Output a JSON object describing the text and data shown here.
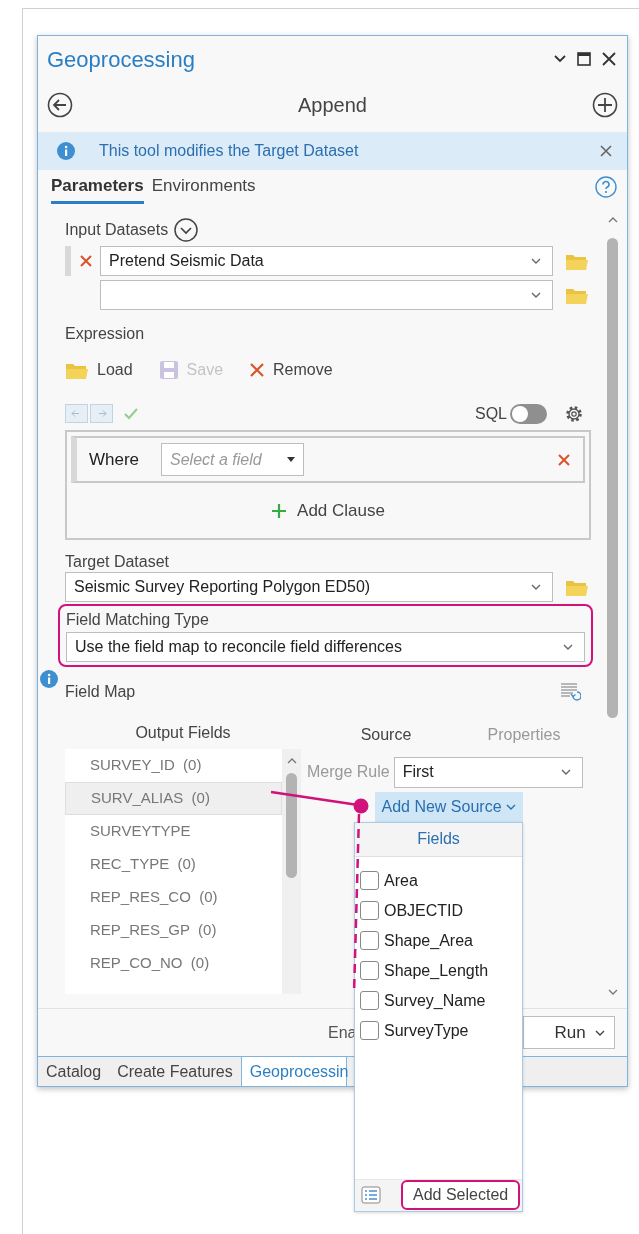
{
  "window": {
    "title": "Geoprocessing"
  },
  "tool": {
    "title": "Append"
  },
  "banner": {
    "text": "This tool modifies the Target Dataset"
  },
  "tabs": [
    {
      "label": "Parameters",
      "selected": true
    },
    {
      "label": "Environments",
      "selected": false
    }
  ],
  "input_datasets": {
    "label": "Input Datasets",
    "rows": [
      {
        "value": "Pretend Seismic Data",
        "removable": true
      },
      {
        "removable": false
      }
    ]
  },
  "expression": {
    "label": "Expression",
    "actions": [
      {
        "kind": "load",
        "label": "Load",
        "disabled": false
      },
      {
        "kind": "save",
        "label": "Save",
        "disabled": true
      },
      {
        "kind": "remove",
        "label": "Remove",
        "disabled": false
      }
    ],
    "sql_label": "SQL",
    "sql_on": false,
    "clause": {
      "label": "Where",
      "placeholder": "Select a field"
    },
    "add_clause": "Add Clause"
  },
  "target_dataset": {
    "label": "Target Dataset",
    "value": "Seismic Survey Reporting Polygon ED50)"
  },
  "field_matching_type": {
    "label": "Field Matching Type",
    "value": "Use the field map to reconcile field differences",
    "highlighted": true
  },
  "field_map": {
    "label": "Field Map",
    "output_fields_header": "Output Fields",
    "output_fields": [
      {
        "name": "SURVEY_ID  (0)",
        "selected": false
      },
      {
        "name": "SURV_ALIAS  (0)",
        "selected": true
      },
      {
        "name": "SURVEYTYPE",
        "selected": false
      },
      {
        "name": "REC_TYPE  (0)",
        "selected": false
      },
      {
        "name": "REP_RES_CO  (0)",
        "selected": false
      },
      {
        "name": "REP_RES_GP  (0)",
        "selected": false
      },
      {
        "name": "REP_CO_NO  (0)",
        "selected": false
      }
    ],
    "source_tabs": [
      {
        "label": "Source",
        "selected": true
      },
      {
        "label": "Properties",
        "selected": false
      }
    ],
    "merge_rule": {
      "label": "Merge Rule",
      "value": "First"
    },
    "add_new_source": "Add New Source"
  },
  "footer": {
    "text": "Ena",
    "run": "Run"
  },
  "bottom_tabs": [
    {
      "label": "Catalog",
      "selected": false
    },
    {
      "label": "Create Features",
      "selected": false
    },
    {
      "label": "Geoprocessin",
      "selected": true
    }
  ],
  "popup": {
    "header": "Fields",
    "fields": [
      {
        "name": "Area",
        "checked": false
      },
      {
        "name": "OBJECTID",
        "checked": false
      },
      {
        "name": "Shape_Area",
        "checked": false
      },
      {
        "name": "Shape_Length",
        "checked": false
      },
      {
        "name": "Survey_Name",
        "checked": false
      },
      {
        "name": "SurveyType",
        "checked": false
      }
    ],
    "button": "Add Selected"
  }
}
